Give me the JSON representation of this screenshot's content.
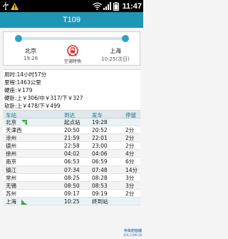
{
  "status_bar": {
    "time": "11:47",
    "icons": [
      "usb-icon",
      "warning-icon",
      "wifi-icon",
      "signal-icon",
      "battery-icon"
    ]
  },
  "title": "T109",
  "route": {
    "from": {
      "name": "北京",
      "time": "19:28"
    },
    "to": {
      "name": "上海",
      "time": "10:25(次日)"
    },
    "train_type": "空调特快"
  },
  "info": {
    "duration": "用时:14小时57分",
    "distance": "里程:1463公里",
    "hard_seat": "硬座:￥179",
    "hard_sleeper": "硬卧:上￥306/中￥317/下￥327",
    "soft_sleeper": "软卧:上￥478/下￥499"
  },
  "table": {
    "headers": {
      "station": "车站",
      "arrive": "到达",
      "depart": "发车",
      "stop": "停留"
    },
    "rows": [
      {
        "station": "北京",
        "arrive": "起点站",
        "depart": "19:28",
        "stop": ""
      },
      {
        "station": "天津西",
        "arrive": "20:50",
        "depart": "20:52",
        "stop": "2分"
      },
      {
        "station": "沧州",
        "arrive": "21:59",
        "depart": "22:01",
        "stop": "2分"
      },
      {
        "station": "德州",
        "arrive": "22:58",
        "depart": "23:00",
        "stop": "2分"
      },
      {
        "station": "徐州",
        "arrive": "04:02",
        "depart": "04:06",
        "stop": "4分"
      },
      {
        "station": "南京",
        "arrive": "06:53",
        "depart": "06:59",
        "stop": "6分"
      },
      {
        "station": "镇江",
        "arrive": "07:34",
        "depart": "07:48",
        "stop": "14分"
      },
      {
        "station": "常州",
        "arrive": "08:25",
        "depart": "08:28",
        "stop": "3分"
      },
      {
        "station": "无锡",
        "arrive": "08:50",
        "depart": "08:53",
        "stop": "3分"
      },
      {
        "station": "苏州",
        "arrive": "09:17",
        "depart": "09:19",
        "stop": "2分"
      },
      {
        "station": "上海",
        "arrive": "10:25",
        "depart": "终到站",
        "stop": ""
      }
    ]
  },
  "watermark": {
    "title": "中关村在线",
    "sub": "ZOL.COM.CN"
  },
  "colors": {
    "accent": "#1f96b6",
    "dot": "#2aa2c7",
    "train_icon": "#e02a2a",
    "flag": "#3aa64a"
  }
}
